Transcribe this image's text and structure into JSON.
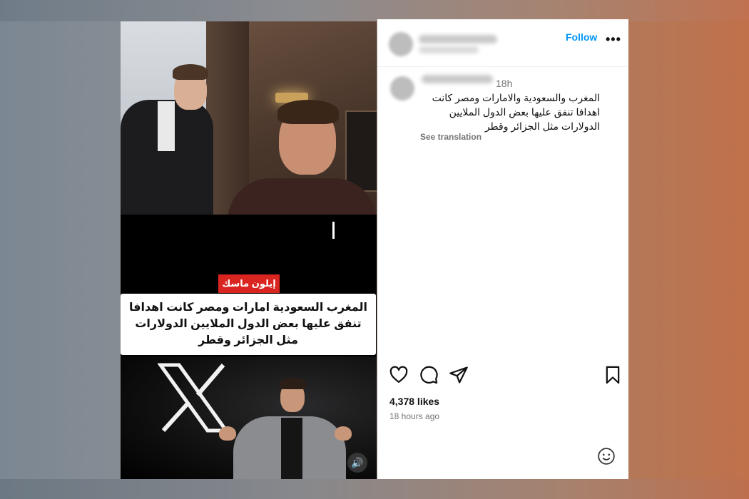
{
  "video": {
    "name_tag": "إيلون ماسك",
    "caption": "المغرب السعودية امارات ومصر كانت اهدافا تنفق عليها بعض الدول الملايين الدولارات مثل الجزائر وقطر",
    "sound_icon": "speaker-icon"
  },
  "post": {
    "follow_label": "Follow",
    "more_label": "•••",
    "comment": {
      "time": "18h",
      "text": "المغرب والسعودية والامارات ومصر كانت اهدافا تنفق عليها بعض الدول الملايين الدولارات مثل الجزائر وقطر",
      "see_translation": "See translation"
    },
    "likes": "4,378 likes",
    "time_ago": "18 hours ago",
    "icons": [
      "heart-icon",
      "comment-icon",
      "share-icon",
      "bookmark-icon",
      "emoji-icon"
    ]
  }
}
